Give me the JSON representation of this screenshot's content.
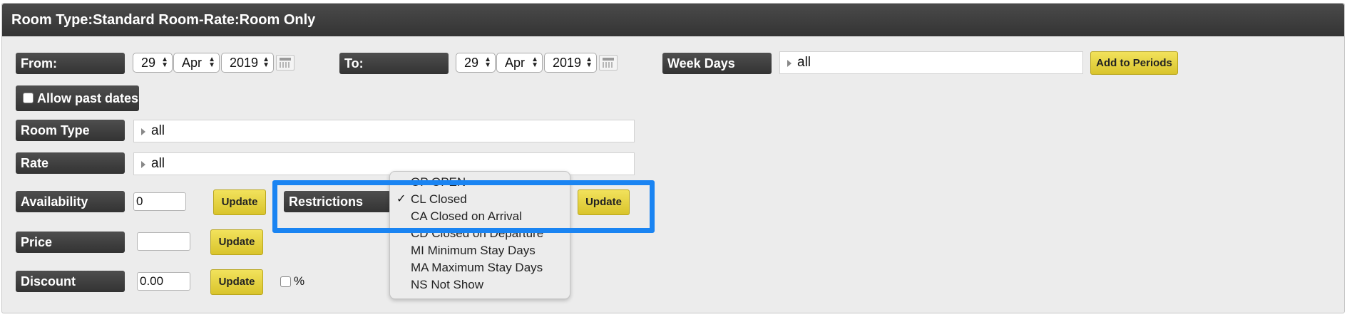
{
  "panel": {
    "title": "Room Type:Standard Room-Rate:Room Only"
  },
  "period": {
    "from_label": "From:",
    "from_day": "29",
    "from_month": "Apr",
    "from_year": "2019",
    "to_label": "To:",
    "to_day": "29",
    "to_month": "Apr",
    "to_year": "2019",
    "weekdays_label": "Week Days",
    "weekdays_value": "all",
    "add_button": "Add to Periods"
  },
  "allow_past_dates": {
    "label": "Allow past dates",
    "checked": false
  },
  "room_type": {
    "label": "Room Type",
    "value": "all"
  },
  "rate": {
    "label": "Rate",
    "value": "all"
  },
  "availability": {
    "label": "Availability",
    "value": "0",
    "update_button": "Update"
  },
  "restrictions": {
    "label": "Restrictions",
    "update_button": "Update",
    "options": [
      "OP OPEN",
      "CL Closed",
      "CA Closed on Arrival",
      "CD Closed on Departure",
      "MI Minimum Stay Days",
      "MA Maximum Stay Days",
      "NS Not Show"
    ],
    "selected": "CL Closed",
    "check_mark": "✓"
  },
  "price": {
    "label": "Price",
    "value": "",
    "update_button": "Update"
  },
  "discount": {
    "label": "Discount",
    "value": "0.00",
    "update_button": "Update",
    "percent_label": "%"
  },
  "colors": {
    "accent_highlight": "#1a84f2",
    "button_yellow": "#e8d543",
    "label_dark": "#3d3d3d"
  }
}
